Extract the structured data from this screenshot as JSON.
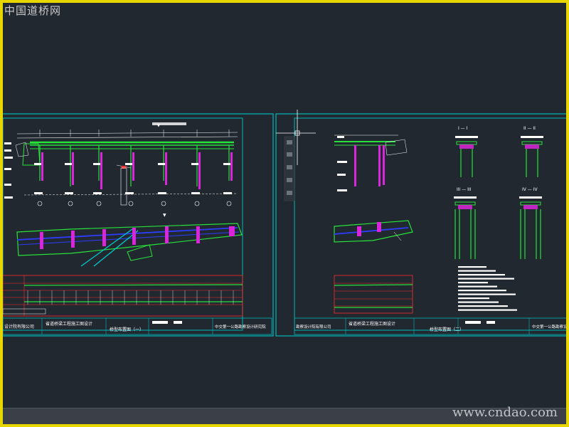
{
  "watermark_top": "中国道桥网",
  "watermark_bottom": "www.cndao.com",
  "sheet1": {
    "company": "设计院有限公司",
    "project": "省道桥梁工程施工图设计",
    "title": "桥型布置图（一）",
    "right_title": "中交第一公路勘察设计研究院"
  },
  "sheet2": {
    "company": "勘察设计院有限公司",
    "project": "省道桥梁工程施工图设计",
    "title": "桥型布置图（二）",
    "right_title": "中交第一公路勘察设计"
  },
  "section_labels": [
    "I — I",
    "II — II",
    "III — III",
    "IV — IV"
  ],
  "colors": {
    "background": "#212830",
    "border": "#00b8b8",
    "structure": "#27e23a",
    "piers": "#d926d9",
    "road": "#2e3cff",
    "text": "#ffffff",
    "accent": "#ff2b2b",
    "cursor": "#ffffff"
  }
}
